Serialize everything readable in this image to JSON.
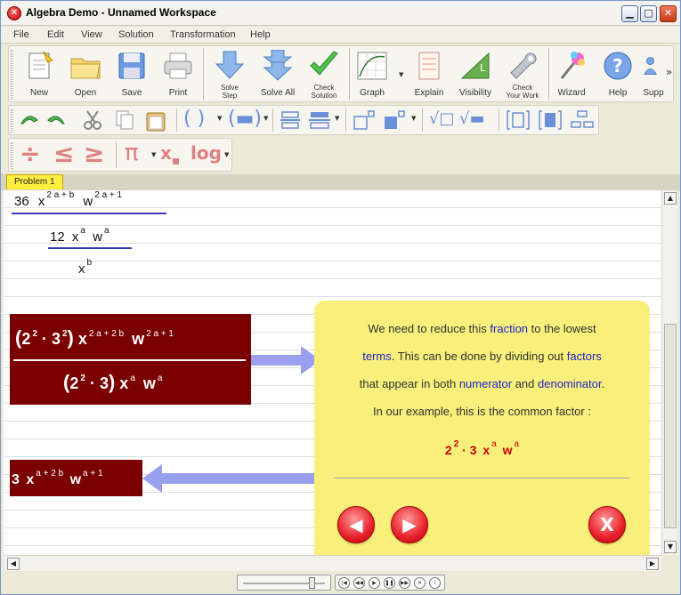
{
  "window": {
    "title": "Algebra Demo - Unnamed Workspace"
  },
  "menu": [
    "File",
    "Edit",
    "View",
    "Solution",
    "Transformation",
    "Help"
  ],
  "toolbar": {
    "new": "New",
    "open": "Open",
    "save": "Save",
    "print": "Print",
    "solve_step_1": "Solve",
    "solve_step_2": "Step",
    "solve_all": "Solve All",
    "check_solution_1": "Check",
    "check_solution_2": "Solution",
    "graph": "Graph",
    "explain": "Explain",
    "visibility": "Visibility",
    "check_work_1": "Check",
    "check_work_2": "Your Work",
    "wizard": "Wizard",
    "help": "Help",
    "support": "Supp",
    "more": "»"
  },
  "symbols": {
    "pi": "π",
    "x_sub": "x",
    "log": "log"
  },
  "tabs": [
    {
      "label": "Problem 1"
    }
  ],
  "workspace": {
    "top_line": {
      "coef": "36",
      "var1": "x",
      "var2": "w",
      "exp1": "2 a + b",
      "exp2": "2 a + 1"
    },
    "mid_fraction": {
      "num_coef": "12",
      "num_var1": "x",
      "num_exp1": "a",
      "num_var2": "w",
      "num_exp2": "a",
      "den_var": "x",
      "den_exp": "b"
    },
    "highlight_fraction": {
      "num_open": "(",
      "num_2": "2",
      "num_2_exp": "2",
      "dot": "·",
      "num_3": "3",
      "num_3_exp": "2",
      "num_close": ")",
      "num_x": "x",
      "num_x_exp": "2 a + 2 b",
      "num_w": "w",
      "num_w_exp": "2 a + 1",
      "den_open": "(",
      "den_2": "2",
      "den_2_exp": "2",
      "den_3": "3",
      "den_close": ")",
      "den_x": "x",
      "den_x_exp": "a",
      "den_w": "w",
      "den_w_exp": "a"
    },
    "result": {
      "coef": "3",
      "x": "x",
      "x_exp": "a + 2 b",
      "w": "w",
      "w_exp": "a + 1"
    }
  },
  "explanation": {
    "line1_pre": "We need to reduce this ",
    "line1_kw": "fraction",
    "line1_post": " to the lowest",
    "line2_kw1": "terms",
    "line2_mid": ". This can be done by dividing out ",
    "line2_kw2": "factors",
    "line3_pre": "that appear in both ",
    "line3_kw1": "numerator",
    "line3_mid": " and ",
    "line3_kw2": "denominator",
    "line3_post": ".",
    "line4": "In our example, this is the common factor :",
    "factor": {
      "base2": "2",
      "exp2": "2",
      "dot": "·",
      "three": "3",
      "x": "x",
      "x_exp": "a",
      "w": "w",
      "w_exp": "a"
    },
    "prev_label": "◀",
    "next_label": "▶",
    "close_label": "X"
  },
  "colors": {
    "accent_maroon": "#7a0000",
    "callout_bg": "#f8f07a",
    "keyword": "#2222cc",
    "factor_red": "#cc0000",
    "arrow": "#9aa0f0"
  }
}
